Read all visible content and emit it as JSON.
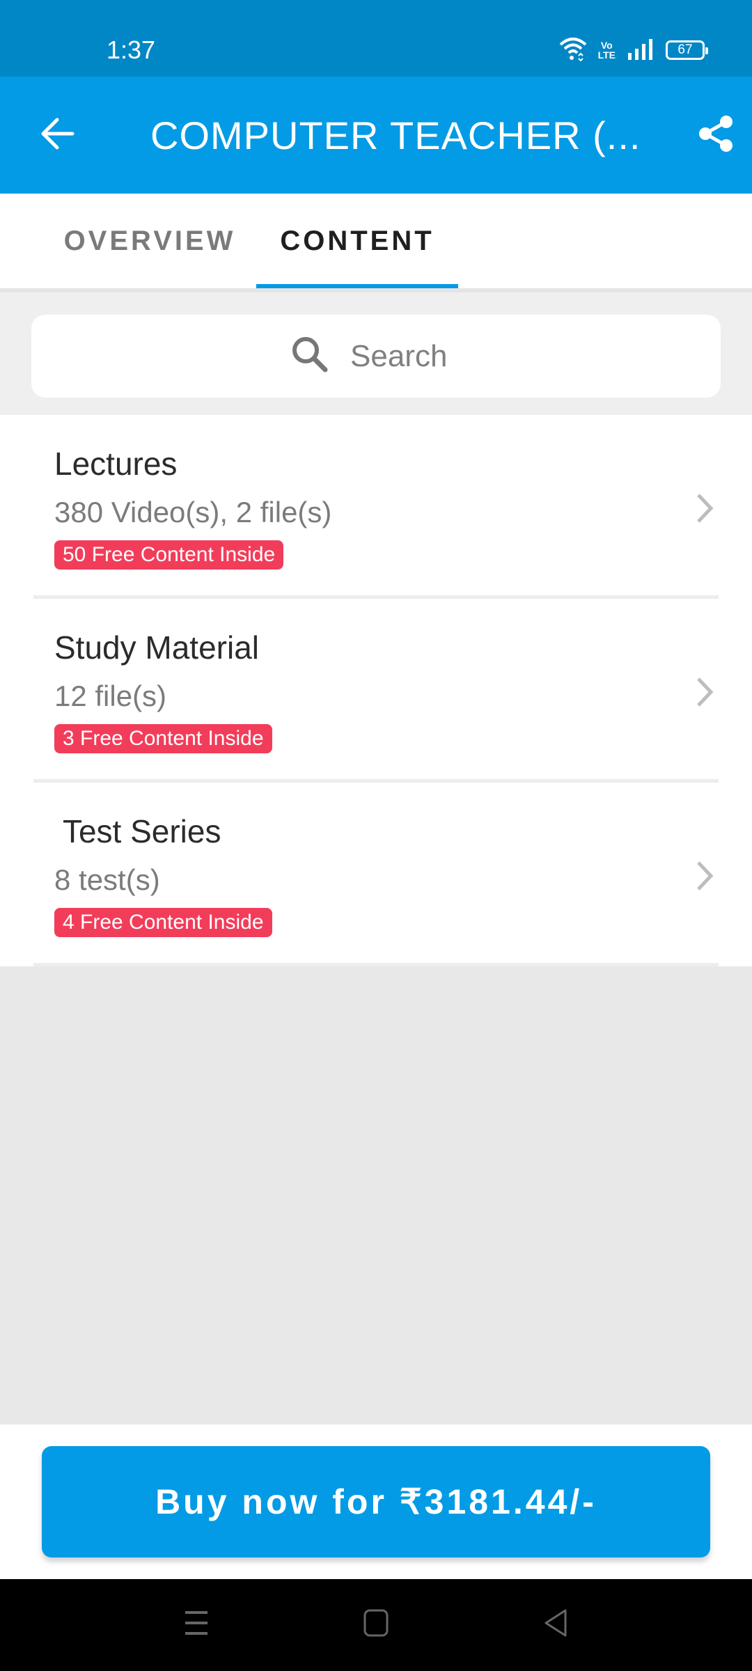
{
  "status_bar": {
    "time": "1:37",
    "battery": "67",
    "network_label_top": "Vo",
    "network_label_bottom": "LTE",
    "icons": [
      "wifi-icon",
      "volte-icon",
      "signal-icon",
      "battery-icon"
    ]
  },
  "app_bar": {
    "title": "COMPUTER TEACHER  (...",
    "back_icon": "arrow-left-icon",
    "share_icon": "share-icon"
  },
  "tabs": [
    {
      "label": "OVERVIEW",
      "active": false
    },
    {
      "label": "CONTENT",
      "active": true
    }
  ],
  "search": {
    "placeholder": "Search",
    "value": ""
  },
  "content_items": [
    {
      "title": "Lectures",
      "subtitle": "380 Video(s), 2 file(s)",
      "badge": "50 Free Content Inside"
    },
    {
      "title": "Study Material",
      "subtitle": "12 file(s)",
      "badge": "3 Free Content Inside"
    },
    {
      "title": " Test Series",
      "subtitle": "8 test(s)",
      "badge": "4 Free Content Inside"
    }
  ],
  "footer": {
    "buy_label": "Buy now for ₹3181.44/-"
  },
  "nav_bar": {
    "buttons": [
      "recents-icon",
      "home-icon",
      "back-icon"
    ]
  },
  "colors": {
    "primary": "#039be5",
    "status_bar": "#0287c6",
    "badge": "#f23d5a"
  }
}
